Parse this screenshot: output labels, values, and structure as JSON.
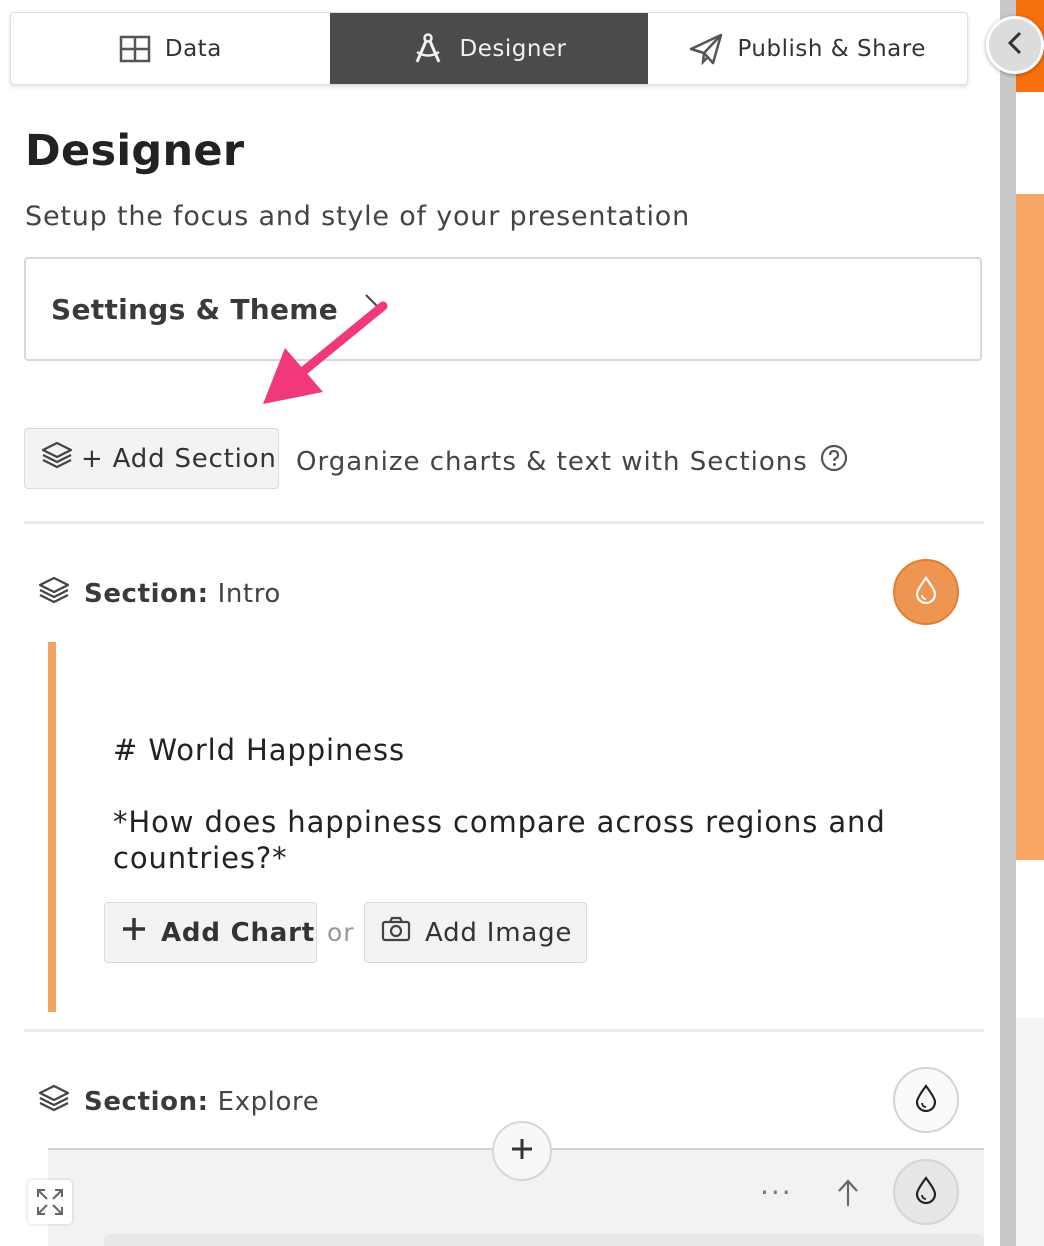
{
  "tabs": [
    {
      "label": "Data",
      "icon": "table-grid-icon",
      "active": false
    },
    {
      "label": "Designer",
      "icon": "compass-pen-icon",
      "active": true
    },
    {
      "label": "Publish & Share",
      "icon": "paper-plane-icon",
      "active": false
    }
  ],
  "page": {
    "title": "Designer",
    "subtitle": "Setup the focus and style of your presentation"
  },
  "settings": {
    "label": "Settings & Theme"
  },
  "add_section": {
    "button_label": "+ Add Section",
    "hint": "Organize charts & text with Sections"
  },
  "sections": [
    {
      "prefix": "Section:",
      "name": "Intro",
      "markdown": [
        "# World Happiness",
        "*How does happiness compare across regions and",
        "countries?*"
      ],
      "add_chart_label": "Add Chart",
      "or_label": "or",
      "add_image_label": "Add Image"
    },
    {
      "prefix": "Section:",
      "name": "Explore",
      "more_label": "···"
    }
  ],
  "colors": {
    "accent_orange": "#f7700f",
    "section_orange": "#f6a35f",
    "arrow_pink": "#f0387a",
    "active_tab": "#4b4b4b"
  }
}
